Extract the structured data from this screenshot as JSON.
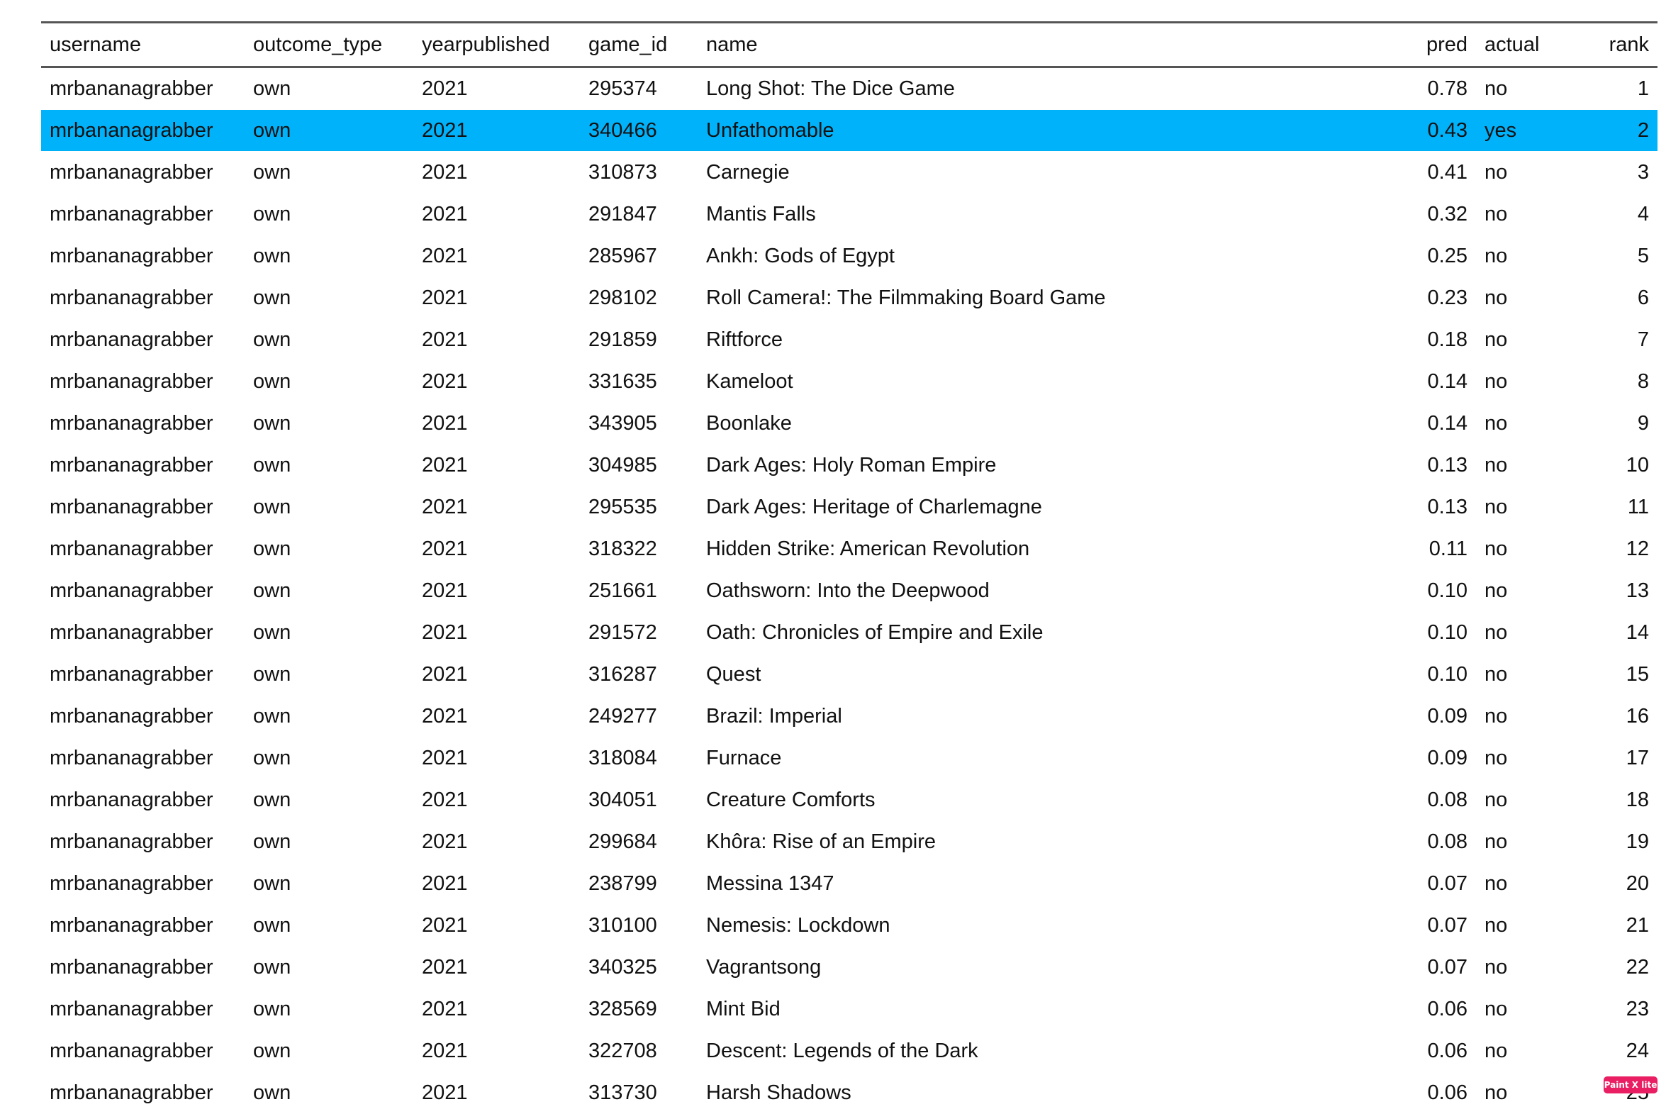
{
  "table": {
    "columns": [
      "username",
      "outcome_type",
      "yearpublished",
      "game_id",
      "name",
      "pred",
      "actual",
      "rank"
    ],
    "rows": [
      [
        "mrbananagrabber",
        "own",
        "2021",
        "295374",
        "Long Shot: The Dice Game",
        "0.78",
        "no",
        "1"
      ],
      [
        "mrbananagrabber",
        "own",
        "2021",
        "340466",
        "Unfathomable",
        "0.43",
        "yes",
        "2"
      ],
      [
        "mrbananagrabber",
        "own",
        "2021",
        "310873",
        "Carnegie",
        "0.41",
        "no",
        "3"
      ],
      [
        "mrbananagrabber",
        "own",
        "2021",
        "291847",
        "Mantis Falls",
        "0.32",
        "no",
        "4"
      ],
      [
        "mrbananagrabber",
        "own",
        "2021",
        "285967",
        "Ankh: Gods of Egypt",
        "0.25",
        "no",
        "5"
      ],
      [
        "mrbananagrabber",
        "own",
        "2021",
        "298102",
        "Roll Camera!: The Filmmaking Board Game",
        "0.23",
        "no",
        "6"
      ],
      [
        "mrbananagrabber",
        "own",
        "2021",
        "291859",
        "Riftforce",
        "0.18",
        "no",
        "7"
      ],
      [
        "mrbananagrabber",
        "own",
        "2021",
        "331635",
        "Kameloot",
        "0.14",
        "no",
        "8"
      ],
      [
        "mrbananagrabber",
        "own",
        "2021",
        "343905",
        "Boonlake",
        "0.14",
        "no",
        "9"
      ],
      [
        "mrbananagrabber",
        "own",
        "2021",
        "304985",
        "Dark Ages: Holy Roman Empire",
        "0.13",
        "no",
        "10"
      ],
      [
        "mrbananagrabber",
        "own",
        "2021",
        "295535",
        "Dark Ages: Heritage of Charlemagne",
        "0.13",
        "no",
        "11"
      ],
      [
        "mrbananagrabber",
        "own",
        "2021",
        "318322",
        "Hidden Strike: American Revolution",
        "0.11",
        "no",
        "12"
      ],
      [
        "mrbananagrabber",
        "own",
        "2021",
        "251661",
        "Oathsworn: Into the Deepwood",
        "0.10",
        "no",
        "13"
      ],
      [
        "mrbananagrabber",
        "own",
        "2021",
        "291572",
        "Oath: Chronicles of Empire and Exile",
        "0.10",
        "no",
        "14"
      ],
      [
        "mrbananagrabber",
        "own",
        "2021",
        "316287",
        "Quest",
        "0.10",
        "no",
        "15"
      ],
      [
        "mrbananagrabber",
        "own",
        "2021",
        "249277",
        "Brazil: Imperial",
        "0.09",
        "no",
        "16"
      ],
      [
        "mrbananagrabber",
        "own",
        "2021",
        "318084",
        "Furnace",
        "0.09",
        "no",
        "17"
      ],
      [
        "mrbananagrabber",
        "own",
        "2021",
        "304051",
        "Creature Comforts",
        "0.08",
        "no",
        "18"
      ],
      [
        "mrbananagrabber",
        "own",
        "2021",
        "299684",
        "Khôra: Rise of an Empire",
        "0.08",
        "no",
        "19"
      ],
      [
        "mrbananagrabber",
        "own",
        "2021",
        "238799",
        "Messina 1347",
        "0.07",
        "no",
        "20"
      ],
      [
        "mrbananagrabber",
        "own",
        "2021",
        "310100",
        "Nemesis: Lockdown",
        "0.07",
        "no",
        "21"
      ],
      [
        "mrbananagrabber",
        "own",
        "2021",
        "340325",
        "Vagrantsong",
        "0.07",
        "no",
        "22"
      ],
      [
        "mrbananagrabber",
        "own",
        "2021",
        "328569",
        "Mint Bid",
        "0.06",
        "no",
        "23"
      ],
      [
        "mrbananagrabber",
        "own",
        "2021",
        "322708",
        "Descent: Legends of the Dark",
        "0.06",
        "no",
        "24"
      ],
      [
        "mrbananagrabber",
        "own",
        "2021",
        "313730",
        "Harsh Shadows",
        "0.06",
        "no",
        "25"
      ]
    ],
    "selected_row": 1
  },
  "colors": {
    "selected_row_bg": "#00b2fa",
    "rule": "#555555",
    "badge": "#e91e63"
  },
  "badge": {
    "label": "Paint X lite"
  }
}
